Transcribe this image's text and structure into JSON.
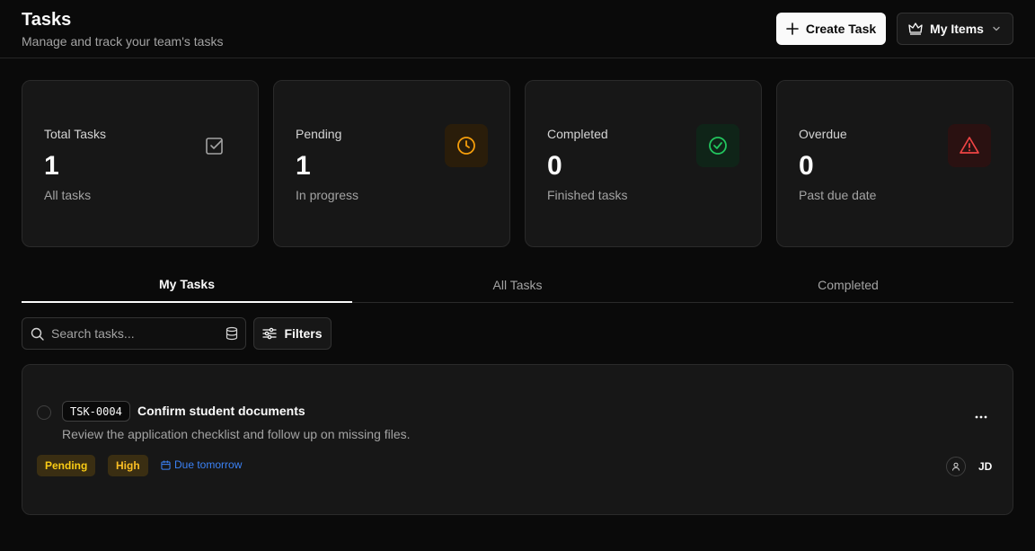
{
  "header": {
    "title": "Tasks",
    "subtitle": "Manage and track your team's tasks",
    "create_label": "Create Task",
    "items_label": "My Items"
  },
  "stats": [
    {
      "label": "Total Tasks",
      "value": "1",
      "note": "All tasks",
      "icon": "checkbox-icon",
      "color": "#a3a3a3"
    },
    {
      "label": "Pending",
      "value": "1",
      "note": "In progress",
      "icon": "clock-icon",
      "color": "#f59e0b"
    },
    {
      "label": "Completed",
      "value": "0",
      "note": "Finished tasks",
      "icon": "check-circle-icon",
      "color": "#22c55e"
    },
    {
      "label": "Overdue",
      "value": "0",
      "note": "Past due date",
      "icon": "alert-triangle-icon",
      "color": "#ef4444"
    }
  ],
  "tabs": [
    {
      "label": "My Tasks",
      "active": true
    },
    {
      "label": "All Tasks",
      "active": false
    },
    {
      "label": "Completed",
      "active": false
    }
  ],
  "search": {
    "placeholder": "Search tasks..."
  },
  "filters_label": "Filters",
  "tasks": [
    {
      "id": "TSK-0004",
      "title": "Confirm student documents",
      "description": "Review the application checklist and follow up on missing files.",
      "status": "Pending",
      "priority": "High",
      "due": "Due tomorrow",
      "assignee": "JD"
    }
  ]
}
